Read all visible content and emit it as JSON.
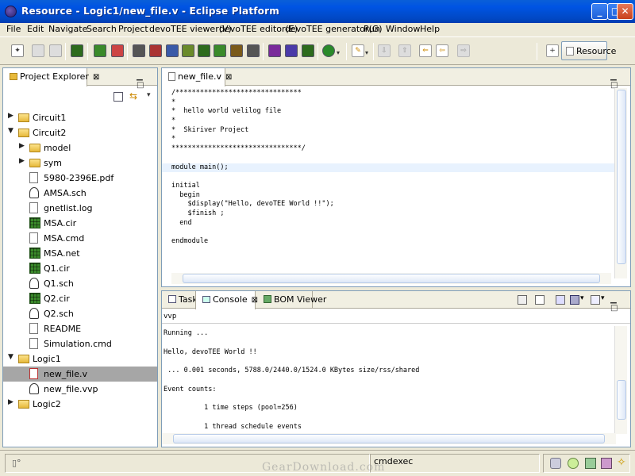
{
  "window": {
    "title": "Resource - Logic1/new_file.v - Eclipse Platform",
    "min_glyph": "_",
    "max_glyph": "□",
    "close_glyph": "✕"
  },
  "menu": [
    "File",
    "Edit",
    "Navigate",
    "Search",
    "Project",
    "devoTEE viewer(V)",
    "devoTEE editor(E)",
    "devoTEE generator(G)",
    "Run",
    "Window",
    "Help"
  ],
  "perspective": {
    "label": "Resource"
  },
  "explorer": {
    "tab_label": "Project Explorer",
    "close_glyph": "⊠",
    "min_max": "▁ □",
    "tree": [
      {
        "label": "Circuit1",
        "twisty": "▶",
        "icon": "project-icon",
        "level": 0
      },
      {
        "label": "Circuit2",
        "twisty": "▼",
        "icon": "project-icon",
        "level": 0
      },
      {
        "label": "model",
        "twisty": "▶",
        "icon": "folder-icon",
        "level": 1
      },
      {
        "label": "sym",
        "twisty": "▶",
        "icon": "folder-icon",
        "level": 1
      },
      {
        "label": "5980-2396E.pdf",
        "twisty": "",
        "icon": "file-icon",
        "level": 1
      },
      {
        "label": "AMSA.sch",
        "twisty": "",
        "icon": "schematic-icon",
        "level": 1
      },
      {
        "label": "gnetlist.log",
        "twisty": "",
        "icon": "file-icon",
        "level": 1
      },
      {
        "label": "MSA.cir",
        "twisty": "",
        "icon": "netlist-icon",
        "level": 1
      },
      {
        "label": "MSA.cmd",
        "twisty": "",
        "icon": "file-icon",
        "level": 1
      },
      {
        "label": "MSA.net",
        "twisty": "",
        "icon": "netlist-icon",
        "level": 1
      },
      {
        "label": "Q1.cir",
        "twisty": "",
        "icon": "netlist-icon",
        "level": 1
      },
      {
        "label": "Q1.sch",
        "twisty": "",
        "icon": "schematic-icon",
        "level": 1
      },
      {
        "label": "Q2.cir",
        "twisty": "",
        "icon": "netlist-icon",
        "level": 1
      },
      {
        "label": "Q2.sch",
        "twisty": "",
        "icon": "schematic-icon",
        "level": 1
      },
      {
        "label": "README",
        "twisty": "",
        "icon": "file-icon",
        "level": 1
      },
      {
        "label": "Simulation.cmd",
        "twisty": "",
        "icon": "file-icon",
        "level": 1
      },
      {
        "label": "Logic1",
        "twisty": "▼",
        "icon": "project-icon",
        "level": 0
      },
      {
        "label": "new_file.v",
        "twisty": "",
        "icon": "verilog-file-icon",
        "level": 1,
        "selected": true
      },
      {
        "label": "new_file.vvp",
        "twisty": "",
        "icon": "vvp-file-icon",
        "level": 1
      },
      {
        "label": "Logic2",
        "twisty": "▶",
        "icon": "project-icon",
        "level": 0
      }
    ]
  },
  "editor": {
    "tab_label": "new_file.v",
    "close_glyph": "⊠",
    "min_max": "▁ □",
    "lines": [
      "/*******************************",
      "*",
      "*  hello world velilog file",
      "*",
      "*  Skiriver Project",
      "*",
      "********************************/",
      "",
      "module main();",
      "",
      "initial",
      "  begin",
      "    $display(\"Hello, devoTEE World !!\");",
      "    $finish ;",
      "  end",
      "",
      "endmodule"
    ],
    "highlighted_line_index": 8
  },
  "console": {
    "tabs": [
      {
        "label": "Tasks",
        "active": false
      },
      {
        "label": "Console",
        "active": true
      },
      {
        "label": "BOM Viewer",
        "active": false
      }
    ],
    "close_glyph": "⊠",
    "min_max": "▁ □",
    "path": "vvp",
    "output": [
      "Running ...",
      "",
      "Hello, devoTEE World !!",
      "",
      " ... 0.001 seconds, 5788.0/2440.0/1524.0 KBytes size/rss/shared",
      "",
      "Event counts:",
      "",
      "          1 time steps (pool=256)",
      "",
      "          1 thread schedule events"
    ]
  },
  "statusbar": {
    "message": "cmdexec",
    "watermark": "GearDownload.com"
  }
}
